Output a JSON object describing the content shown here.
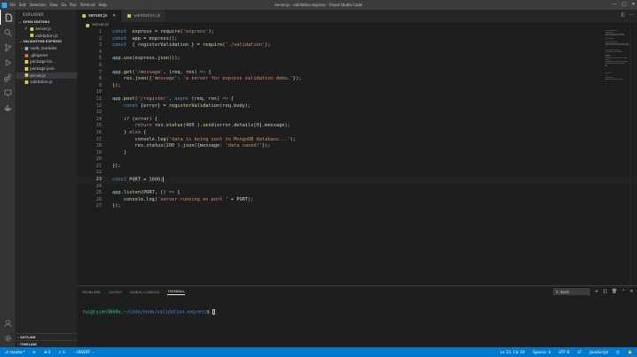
{
  "window": {
    "title": "server.js - validation-express - Visual Studio Code",
    "menu": [
      "File",
      "Edit",
      "Selection",
      "View",
      "Go",
      "Run",
      "Terminal",
      "Help"
    ]
  },
  "activity_bar": [
    "explorer-icon",
    "search-icon",
    "source-control-icon",
    "run-debug-icon",
    "extensions-icon",
    "remote-explorer-icon",
    "docker-icon"
  ],
  "sidebar": {
    "header": "EXPLORER",
    "open_editors_label": "OPEN EDITORS",
    "open_editors": [
      {
        "name": "server.js",
        "icon": "js-file-icon"
      },
      {
        "name": "validation.js",
        "icon": "js-file-icon"
      }
    ],
    "project_label": "VALIDATION-EXPRESS",
    "files": [
      {
        "name": "node_modules",
        "icon": "folder-icon"
      },
      {
        "name": ".gitignore",
        "icon": "git-file-icon"
      },
      {
        "name": "package-loc...",
        "icon": "json-file-icon"
      },
      {
        "name": "package.json",
        "icon": "json-file-icon"
      },
      {
        "name": "server.js",
        "icon": "js-file-icon",
        "selected": true
      },
      {
        "name": "validation.js",
        "icon": "js-file-icon"
      }
    ],
    "outline_label": "OUTLINE",
    "timeline_label": "TIMELINE"
  },
  "tabs": [
    {
      "label": "server.js",
      "active": true
    },
    {
      "label": "validation.js",
      "active": false
    }
  ],
  "breadcrumb": "server.js",
  "editor": {
    "current_line": 23,
    "lines": [
      [
        [
          "kw",
          "const"
        ],
        [
          "",
          "  express = "
        ],
        [
          "fn",
          "require"
        ],
        [
          "",
          "("
        ],
        [
          "str",
          "'express'"
        ],
        [
          "",
          ");"
        ]
      ],
      [
        [
          "kw",
          "const"
        ],
        [
          "",
          "  app = "
        ],
        [
          "fn",
          "express"
        ],
        [
          "",
          "();"
        ]
      ],
      [
        [
          "kw",
          "const"
        ],
        [
          "",
          "  { registerValidation } = "
        ],
        [
          "fn",
          "require"
        ],
        [
          "",
          "("
        ],
        [
          "str",
          "'./validation'"
        ],
        [
          "",
          ");"
        ]
      ],
      [],
      [
        [
          "var",
          "app"
        ],
        [
          "",
          "."
        ],
        [
          "fn",
          "use"
        ],
        [
          "",
          "(express."
        ],
        [
          "fn",
          "json"
        ],
        [
          "",
          "());"
        ]
      ],
      [],
      [
        [
          "var",
          "app"
        ],
        [
          "",
          "."
        ],
        [
          "fn",
          "get"
        ],
        [
          "",
          "("
        ],
        [
          "str",
          "'/message'"
        ],
        [
          "",
          ", (req, res) "
        ],
        [
          "kw",
          "=>"
        ],
        [
          "",
          " {"
        ]
      ],
      [
        [
          "",
          "    res."
        ],
        [
          "fn",
          "json"
        ],
        [
          "",
          "({"
        ],
        [
          "str",
          "'message'"
        ],
        [
          "",
          ": "
        ],
        [
          "str",
          "'a server for express validation demo.'"
        ],
        [
          "",
          "});"
        ]
      ],
      [
        [
          "",
          "});"
        ]
      ],
      [],
      [
        [
          "var",
          "app"
        ],
        [
          "",
          "."
        ],
        [
          "fn",
          "post"
        ],
        [
          "",
          "("
        ],
        [
          "str",
          "'/register'"
        ],
        [
          "",
          ", "
        ],
        [
          "kw",
          "async"
        ],
        [
          "",
          " (req, res) "
        ],
        [
          "kw",
          "=>"
        ],
        [
          "",
          " {"
        ]
      ],
      [
        [
          "",
          "    "
        ],
        [
          "kw",
          "const"
        ],
        [
          "",
          " {error} = "
        ],
        [
          "fn",
          "registerValidation"
        ],
        [
          "",
          "(req.body);"
        ]
      ],
      [],
      [
        [
          "",
          "    "
        ],
        [
          "ctl",
          "if"
        ],
        [
          "",
          " (error) {"
        ]
      ],
      [
        [
          "",
          "        "
        ],
        [
          "ctl",
          "return"
        ],
        [
          "",
          " res."
        ],
        [
          "fn",
          "status"
        ],
        [
          "",
          "("
        ],
        [
          "num",
          "400"
        ],
        [
          "",
          " )."
        ],
        [
          "fn",
          "send"
        ],
        [
          "",
          "(error.details["
        ],
        [
          "num",
          "0"
        ],
        [
          "",
          "].message);"
        ]
      ],
      [
        [
          "",
          "    } "
        ],
        [
          "ctl",
          "else"
        ],
        [
          "",
          " {"
        ]
      ],
      [
        [
          "",
          "        console."
        ],
        [
          "fn",
          "log"
        ],
        [
          "",
          "("
        ],
        [
          "str",
          "'data is being sent to MongoDB database...'"
        ],
        [
          "",
          ");"
        ]
      ],
      [
        [
          "",
          "        res."
        ],
        [
          "fn",
          "status"
        ],
        [
          "",
          "("
        ],
        [
          "num",
          "200"
        ],
        [
          "",
          " )."
        ],
        [
          "fn",
          "json"
        ],
        [
          "",
          "({message: "
        ],
        [
          "str",
          "'data saved!'"
        ],
        [
          "",
          "});"
        ]
      ],
      [
        [
          "",
          "    }"
        ]
      ],
      [],
      [
        [
          "",
          "});"
        ]
      ],
      [],
      [
        [
          "kw",
          "const"
        ],
        [
          "",
          " PORT = "
        ],
        [
          "num",
          "3000"
        ],
        [
          "",
          ";"
        ]
      ],
      [],
      [
        [
          "var",
          "app"
        ],
        [
          "",
          "."
        ],
        [
          "fn",
          "listen"
        ],
        [
          "",
          "(PORT, () "
        ],
        [
          "kw",
          "=>"
        ],
        [
          "",
          " {"
        ]
      ],
      [
        [
          "",
          "    console."
        ],
        [
          "fn",
          "log"
        ],
        [
          "",
          "("
        ],
        [
          "str",
          "'server running on port '"
        ],
        [
          "",
          " + PORT);"
        ]
      ],
      [
        [
          "",
          "});"
        ]
      ]
    ]
  },
  "panel": {
    "tabs": [
      {
        "label": "PROBLEMS",
        "active": false
      },
      {
        "label": "OUTPUT",
        "active": false
      },
      {
        "label": "DEBUG CONSOLE",
        "active": false
      },
      {
        "label": "TERMINAL",
        "active": true
      }
    ],
    "terminal_selected": "1: bash",
    "prompt_user": "rui@ryzen3600x",
    "prompt_path": ":~/Code/node/validation-express",
    "prompt_symbol": "$"
  },
  "status_bar": {
    "branch": "master*",
    "sync": "⟳",
    "errors": "⊗ 0",
    "warnings": "⚠ 0",
    "mode": "-- INSERT --",
    "position": "Ln 23, Col 19",
    "spaces": "Spaces: 4",
    "encoding": "UTF-8",
    "eol": "LF",
    "language": "JavaScript"
  }
}
